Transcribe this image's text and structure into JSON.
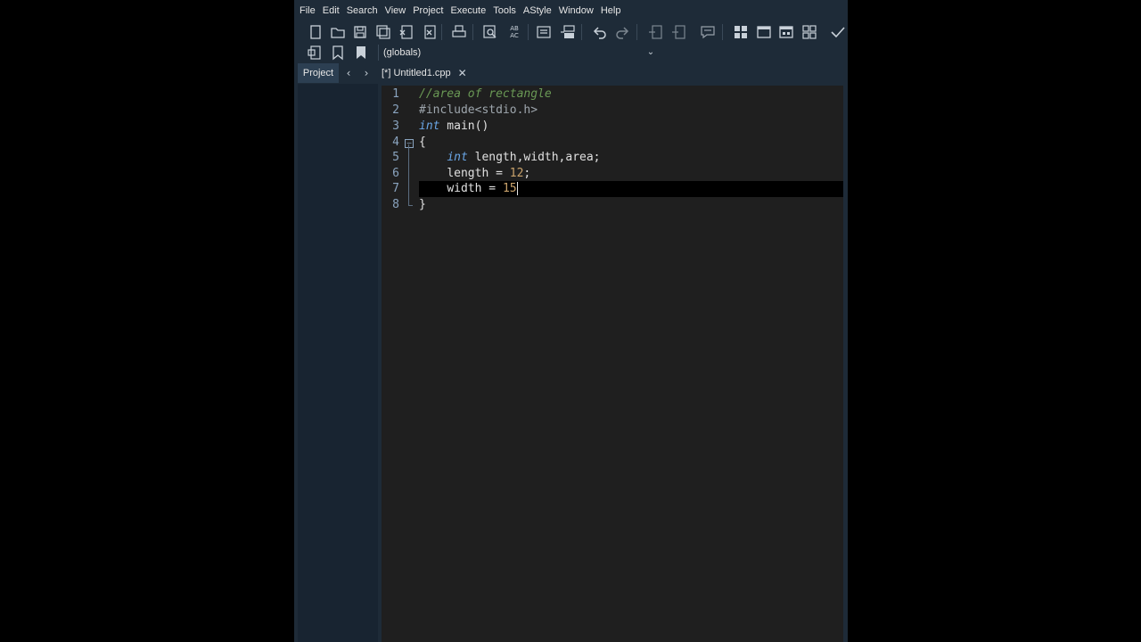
{
  "menu": [
    "File",
    "Edit",
    "Search",
    "View",
    "Project",
    "Execute",
    "Tools",
    "AStyle",
    "Window",
    "Help"
  ],
  "toolbar": {
    "icons": [
      "new-file-icon",
      "open-file-icon",
      "save-icon",
      "save-all-icon",
      "close-file-icon",
      "close-all-icon",
      "print-icon",
      "find-icon",
      "replace-icon",
      "indent-icon",
      "unindent-icon",
      "undo-icon",
      "redo-icon",
      "goto-line-icon",
      "goto-icon",
      "comment-icon",
      "layout-grid-icon",
      "layout-window-icon",
      "layout-table-icon",
      "layout-tiles-icon",
      "check-icon"
    ]
  },
  "toolbar2": {
    "icons": [
      "class-browser-icon",
      "bookmark-icon",
      "bookmark-filled-icon"
    ],
    "scope_value": "(globals)"
  },
  "tabs": {
    "project_label": "Project",
    "file_tab_label": "[*] Untitled1.cpp"
  },
  "editor": {
    "line_numbers": [
      "1",
      "2",
      "3",
      "4",
      "5",
      "6",
      "7",
      "8"
    ],
    "lines": [
      {
        "text": "//area of rectangle"
      },
      {
        "text": "#include<stdio.h>"
      },
      {
        "kw": "int",
        "rest": " main()"
      },
      {
        "text": "{"
      },
      {
        "indent": "    ",
        "kw": "int",
        "rest": " length,width,area;"
      },
      {
        "indent": "    ",
        "prefix": "length = ",
        "num": "12",
        "suffix": ";"
      },
      {
        "indent": "    ",
        "prefix": "width = ",
        "num": "15"
      },
      {
        "text": "}"
      }
    ],
    "current_line": 7
  },
  "colors": {
    "ide_bg": "#1e2b38",
    "editor_bg": "#1f1f1f",
    "comment": "#6a9955",
    "keyword": "#6aa6e6",
    "number": "#c9a26b"
  }
}
